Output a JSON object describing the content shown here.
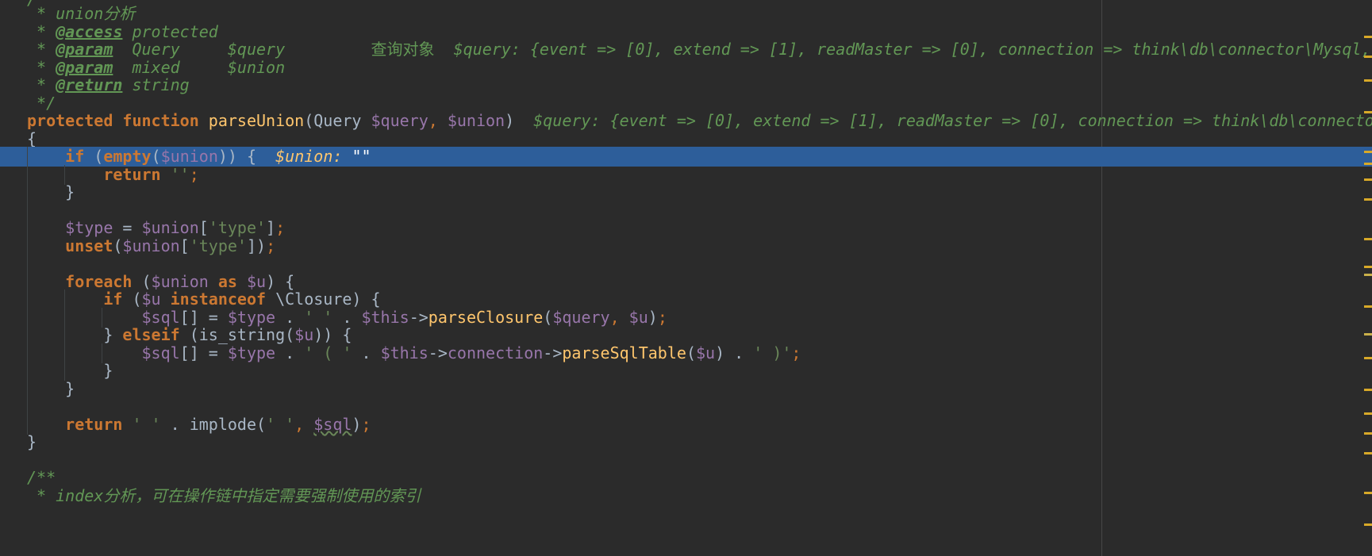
{
  "editor": {
    "lines": [
      {
        "text": "/**",
        "class": "cm"
      },
      {
        "text": " * union分析",
        "class": "cm"
      },
      {
        "text": " * @access protected",
        "class": "cm"
      },
      {
        "text": " * @param  Query     $query         查询对象  $query: {event => [0], extend => [1], readMaster => [0], connection => think\\db\\connector\\Mysql, model",
        "class": "cm"
      },
      {
        "text": " * @param  mixed     $union",
        "class": "cm"
      },
      {
        "text": " * @return string",
        "class": "cm"
      },
      {
        "text": " */",
        "class": "cm"
      },
      {
        "text": "protected function parseUnion(Query $query, $union)  $query: {event => [0], extend => [1], readMaster => [0], connection => think\\db\\connector\\My",
        "class": "code"
      },
      {
        "text": "{",
        "class": "plain"
      },
      {
        "text": "    if (empty($union)) {  $union: \"\"",
        "class": "code",
        "highlighted": true
      },
      {
        "text": "        return '';",
        "class": "code"
      },
      {
        "text": "    }",
        "class": "plain"
      },
      {
        "text": "",
        "class": "plain"
      },
      {
        "text": "    $type = $union['type'];",
        "class": "code"
      },
      {
        "text": "    unset($union['type']);",
        "class": "code"
      },
      {
        "text": "",
        "class": "plain"
      },
      {
        "text": "    foreach ($union as $u) {",
        "class": "code"
      },
      {
        "text": "        if ($u instanceof \\Closure) {",
        "class": "code"
      },
      {
        "text": "            $sql[] = $type . ' ' . $this->parseClosure($query, $u);",
        "class": "code"
      },
      {
        "text": "        } elseif (is_string($u)) {",
        "class": "code"
      },
      {
        "text": "            $sql[] = $type . ' ( ' . $this->connection->parseSqlTable($u) . ' )';",
        "class": "code"
      },
      {
        "text": "        }",
        "class": "plain"
      },
      {
        "text": "    }",
        "class": "plain"
      },
      {
        "text": "",
        "class": "plain"
      },
      {
        "text": "    return ' ' . implode(' ', $sql);",
        "class": "code"
      },
      {
        "text": "}",
        "class": "plain"
      },
      {
        "text": "",
        "class": "plain"
      },
      {
        "text": "/**",
        "class": "cm"
      },
      {
        "text": " * index分析，可在操作链中指定需要强制使用的索引",
        "class": "cm"
      }
    ]
  },
  "colors": {
    "background": "#2b2b2b",
    "selection": "#2d5e9a",
    "keyword": "#cc7832",
    "function": "#ffc66d",
    "variable": "#9876aa",
    "string": "#6a8759",
    "comment": "#629755",
    "plain": "#a9b7c6"
  }
}
